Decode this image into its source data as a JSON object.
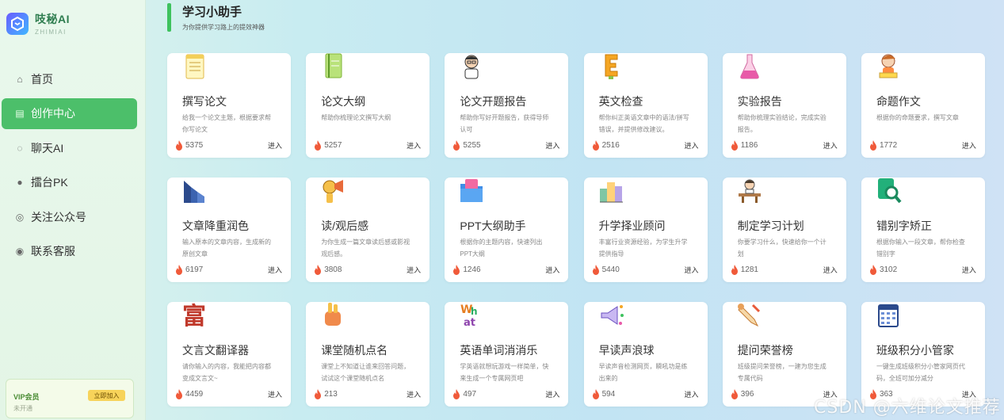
{
  "brand": {
    "name": "吱秘AI",
    "sub": "ZHIMIAI",
    "logo_icon": "brand-logo-icon"
  },
  "nav": [
    {
      "id": "home",
      "label": "首页",
      "icon": "home-icon",
      "glyph": "⌂",
      "active": false
    },
    {
      "id": "create",
      "label": "创作中心",
      "icon": "document-icon",
      "glyph": "▤",
      "active": true
    },
    {
      "id": "chat",
      "label": "聊天AI",
      "icon": "chat-icon",
      "glyph": "◌",
      "active": false
    },
    {
      "id": "pk",
      "label": "擂台PK",
      "icon": "trophy-icon",
      "glyph": "●",
      "active": false
    },
    {
      "id": "follow",
      "label": "关注公众号",
      "icon": "wechat-icon",
      "glyph": "◎",
      "active": false
    },
    {
      "id": "contact",
      "label": "联系客服",
      "icon": "location-icon",
      "glyph": "◉",
      "active": false
    }
  ],
  "vip": {
    "title": "VIP会员",
    "status": "未开通",
    "button": "立即加入"
  },
  "header": {
    "title": "学习小助手",
    "subtitle": "为你提供学习路上的提效神器"
  },
  "enter_label": "进入",
  "cards": [
    {
      "title": "撰写论文",
      "desc": "给我一个论文主题，根据要求帮你写论文",
      "count": "5375",
      "icon": "notepad-icon"
    },
    {
      "title": "论文大纲",
      "desc": "帮助你梳理论文撰写大纲",
      "count": "5257",
      "icon": "notebook-icon"
    },
    {
      "title": "论文开题报告",
      "desc": "帮助你写好开题报告，获得导师认可",
      "count": "5255",
      "icon": "professor-icon"
    },
    {
      "title": "英文检查",
      "desc": "帮你纠正英语文章中的语法/拼写错误，并提供修改建议。",
      "count": "2516",
      "icon": "letter-e-icon"
    },
    {
      "title": "实验报告",
      "desc": "帮助你梳理实验结论，完成实验报告。",
      "count": "1186",
      "icon": "flask-icon"
    },
    {
      "title": "命题作文",
      "desc": "根据你的命题要求，撰写文章",
      "count": "1772",
      "icon": "student-icon"
    },
    {
      "title": "文章降重润色",
      "desc": "输入原本的文章内容，生成新的原创文章",
      "count": "6197",
      "icon": "chart-blocks-icon"
    },
    {
      "title": "读/观后感",
      "desc": "为你生成一篇文章读后感或影视观后感。",
      "count": "3808",
      "icon": "megaphone-character-icon"
    },
    {
      "title": "PPT大纲助手",
      "desc": "根据你的主题内容，快速列出PPT大纲",
      "count": "1246",
      "icon": "folder-icon"
    },
    {
      "title": "升学择业顾问",
      "desc": "丰富行业资源经验，为学生升学提供指导",
      "count": "5440",
      "icon": "city-icon"
    },
    {
      "title": "制定学习计划",
      "desc": "你要学习什么，快速给你一个计划",
      "count": "1281",
      "icon": "desk-study-icon"
    },
    {
      "title": "错别字矫正",
      "desc": "根据你输入一段文章，帮你检查错别字",
      "count": "3102",
      "icon": "magnifier-doc-icon"
    },
    {
      "title": "文言文翻译器",
      "desc": "请你输入的内容，我能把内容都变成文言文~",
      "count": "4459",
      "icon": "chinese-character-icon"
    },
    {
      "title": "课堂随机点名",
      "desc": "课堂上不知道让谁来回答问题，试试这个课堂随机点名",
      "count": "213",
      "icon": "hand-raise-icon"
    },
    {
      "title": "英语单词消消乐",
      "desc": "学英语就想玩游戏一样简单，快来生成一个专属网页吧",
      "count": "497",
      "icon": "what-letters-icon"
    },
    {
      "title": "早读声浪球",
      "desc": "早读声音检测网页，瞬吼功是练出来的",
      "count": "594",
      "icon": "loudspeaker-icon"
    },
    {
      "title": "提问荣誉榜",
      "desc": "班级提问荣誉榜，一建为您生成专属代码",
      "count": "396",
      "icon": "scroll-icon"
    },
    {
      "title": "班级积分小管家",
      "desc": "一键生成班级积分小管家网页代码，全班可加分减分",
      "count": "363",
      "icon": "calendar-icon"
    }
  ],
  "watermark": "CSDN @六维论文推荐"
}
